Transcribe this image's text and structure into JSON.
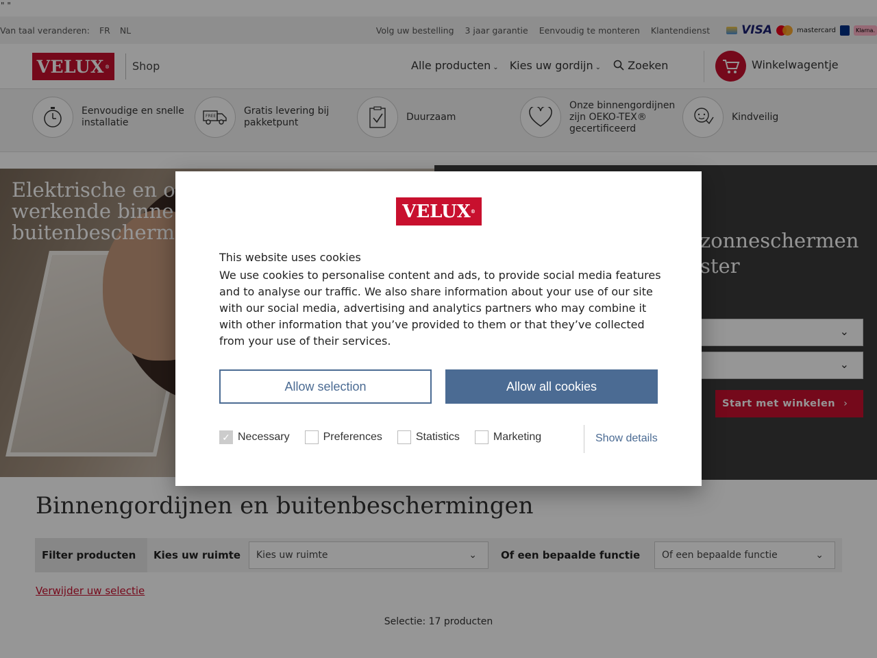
{
  "stray_text": "\" \"",
  "topbar": {
    "lang_label": "Van taal veranderen:",
    "lang_fr": "FR",
    "lang_nl": "NL",
    "links": [
      "Volg uw bestelling",
      "3 jaar garantie",
      "Eenvoudig te monteren",
      "Klantendienst"
    ],
    "payments": {
      "visa": "VISA",
      "mastercard": "mastercard",
      "klarna": "Klarna."
    }
  },
  "header": {
    "logo": "VELUX",
    "shop": "Shop",
    "nav": [
      "Alle producten",
      "Kies uw gordijn"
    ],
    "search": "Zoeken",
    "cart": "Winkelwagentje"
  },
  "usps": [
    {
      "icon": "stopwatch-icon",
      "text": "Eenvoudige en snelle installatie"
    },
    {
      "icon": "delivery-truck-icon",
      "text": "Gratis levering bij pakketpunt"
    },
    {
      "icon": "checklist-icon",
      "text": "Duurzaam"
    },
    {
      "icon": "heart-icon",
      "text": "Onze binnengordijnen zijn OEKO-TEX® gecertificeerd"
    },
    {
      "icon": "child-face-icon",
      "text": "Kindveilig"
    }
  ],
  "hero": {
    "headline": "Elektrische en o\nwerkende binne\nbuitenbescherm",
    "panel_title": "zonneschermen\nster",
    "start_button": "Start met winkelen"
  },
  "listing": {
    "title": "Binnengordijnen en buitenbeschermingen",
    "filter_label": "Filter producten",
    "room_label": "Kies uw ruimte",
    "room_placeholder": "Kies uw ruimte",
    "function_label": "Of een bepaalde functie",
    "function_placeholder": "Of een bepaalde functie",
    "remove_selection": "Verwijder uw selectie",
    "count": "Selectie: 17 producten"
  },
  "cookie_modal": {
    "logo": "VELUX",
    "title": "This website uses cookies",
    "body": "We use cookies to personalise content and ads, to provide social media features and to analyse our traffic. We also share information about your use of our site with our social media, advertising and analytics partners who may combine it with other information that you’ve provided to them or that they’ve collected from your use of their services.",
    "allow_selection": "Allow selection",
    "allow_all": "Allow all cookies",
    "checkboxes": [
      {
        "label": "Necessary",
        "checked": true
      },
      {
        "label": "Preferences",
        "checked": false
      },
      {
        "label": "Statistics",
        "checked": false
      },
      {
        "label": "Marketing",
        "checked": false
      }
    ],
    "show_details": "Show details"
  },
  "colors": {
    "brand_red": "#c8102e",
    "cookie_blue": "#4b6b93"
  }
}
